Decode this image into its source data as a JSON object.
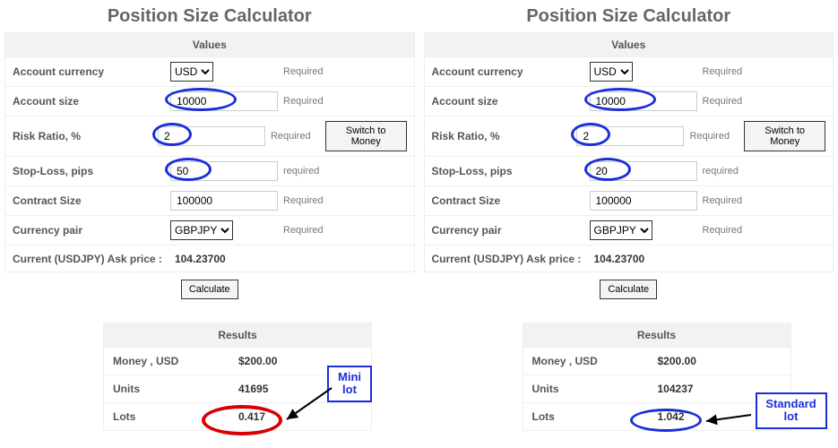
{
  "left": {
    "title": "Position Size Calculator",
    "valuesHeader": "Values",
    "rows": {
      "currency": {
        "label": "Account currency",
        "value": "USD",
        "req": "Required"
      },
      "size": {
        "label": "Account size",
        "value": "10000",
        "req": "Required"
      },
      "risk": {
        "label": "Risk Ratio, %",
        "value": "2",
        "req": "Required",
        "switch": "Switch to Money"
      },
      "stop": {
        "label": "Stop-Loss, pips",
        "value": "50",
        "req": "required"
      },
      "contract": {
        "label": "Contract Size",
        "value": "100000",
        "req": "Required"
      },
      "pair": {
        "label": "Currency pair",
        "value": "GBPJPY",
        "req": "Required"
      },
      "ask": {
        "label": "Current (USDJPY) Ask price :",
        "value": "104.23700"
      }
    },
    "calculate": "Calculate",
    "results": {
      "header": "Results",
      "money": {
        "label": "Money , USD",
        "value": "$200.00"
      },
      "units": {
        "label": "Units",
        "value": "41695"
      },
      "lots": {
        "label": "Lots",
        "value": "0.417"
      }
    },
    "callout": "Mini lot"
  },
  "right": {
    "title": "Position Size Calculator",
    "valuesHeader": "Values",
    "rows": {
      "currency": {
        "label": "Account currency",
        "value": "USD",
        "req": "Required"
      },
      "size": {
        "label": "Account size",
        "value": "10000",
        "req": "Required"
      },
      "risk": {
        "label": "Risk Ratio, %",
        "value": "2",
        "req": "Required",
        "switch": "Switch to Money"
      },
      "stop": {
        "label": "Stop-Loss, pips",
        "value": "20",
        "req": "required"
      },
      "contract": {
        "label": "Contract Size",
        "value": "100000",
        "req": "Required"
      },
      "pair": {
        "label": "Currency pair",
        "value": "GBPJPY",
        "req": "Required"
      },
      "ask": {
        "label": "Current (USDJPY) Ask price :",
        "value": "104.23700"
      }
    },
    "calculate": "Calculate",
    "results": {
      "header": "Results",
      "money": {
        "label": "Money , USD",
        "value": "$200.00"
      },
      "units": {
        "label": "Units",
        "value": "104237"
      },
      "lots": {
        "label": "Lots",
        "value": "1.042"
      }
    },
    "callout": "Standard lot"
  }
}
